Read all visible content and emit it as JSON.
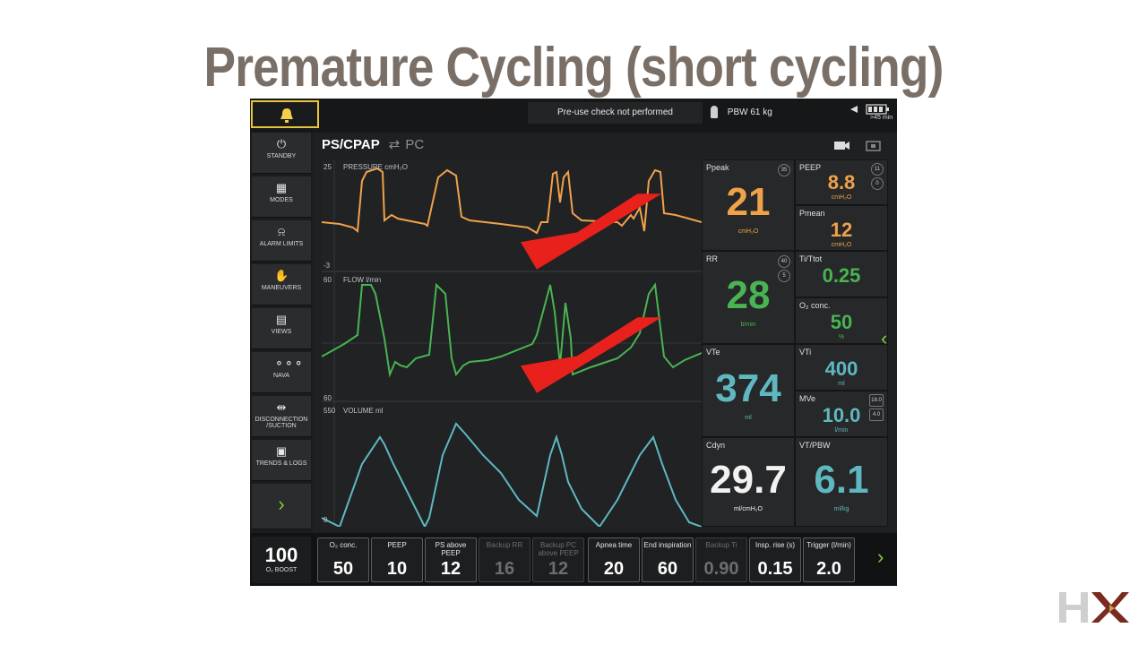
{
  "slide": {
    "title": "Premature Cycling (short cycling)"
  },
  "topbar": {
    "precheck": "Pre-use check not performed",
    "pbw": "PBW 61 kg",
    "battery_time": ">45 min"
  },
  "sidebar": {
    "items": [
      {
        "label": "STANDBY",
        "icon": "power-icon"
      },
      {
        "label": "MODES",
        "icon": "grid-icon"
      },
      {
        "label": "ALARM LIMITS",
        "icon": "alarm-limits-icon"
      },
      {
        "label": "MANEUVERS",
        "icon": "hand-icon"
      },
      {
        "label": "VIEWS",
        "icon": "views-icon"
      },
      {
        "label": "NAVA",
        "icon": "nava-icon"
      },
      {
        "label": "DISCONNECTION /SUCTION",
        "icon": "disconnect-icon"
      },
      {
        "label": "TRENDS & LOGS",
        "icon": "trends-icon"
      }
    ]
  },
  "mode": {
    "current": "PS/CPAP",
    "alternate": "PC"
  },
  "waveforms": {
    "pressure": {
      "label": "PRESSURE cmH₂O",
      "ymax": "25",
      "ymin": "-3",
      "color": "#f0a24a"
    },
    "flow": {
      "label": "FLOW l/min",
      "ymax": "60",
      "ymin": "60",
      "color": "#49b451"
    },
    "volume": {
      "label": "VOLUME ml",
      "ymax": "550",
      "ymin": "0",
      "color": "#5fb8c0"
    }
  },
  "measured": {
    "ppeak": {
      "label": "Ppeak",
      "value": "21",
      "unit": "cmH₂O",
      "limit": "35"
    },
    "peep": {
      "label": "PEEP",
      "value": "8.8",
      "unit": "cmH₂O",
      "limit_hi": "11",
      "limit_lo": "0"
    },
    "pmean": {
      "label": "Pmean",
      "value": "12",
      "unit": "cmH₂O"
    },
    "rr": {
      "label": "RR",
      "value": "28",
      "unit": "b/min",
      "limit_hi": "40",
      "limit_lo": "5"
    },
    "ti_ttot": {
      "label": "Ti/Ttot",
      "value": "0.25"
    },
    "o2": {
      "label": "O₂ conc.",
      "value": "50",
      "unit": "%"
    },
    "vte": {
      "label": "VTe",
      "value": "374",
      "unit": "ml"
    },
    "vti": {
      "label": "VTi",
      "value": "400",
      "unit": "ml"
    },
    "mve": {
      "label": "MVe",
      "value": "10.0",
      "unit": "l/min",
      "limit_hi": "18.0",
      "limit_lo": "4.0"
    },
    "cdyn": {
      "label": "Cdyn",
      "value": "29.7",
      "unit": "ml/cmH₂O"
    },
    "vt_pbw": {
      "label": "VT/PBW",
      "value": "6.1",
      "unit": "ml/kg"
    }
  },
  "settings": {
    "boost": {
      "value": "100",
      "label": "O₂ BOOST"
    },
    "items": [
      {
        "label": "O₂ conc.",
        "value": "50",
        "enabled": true
      },
      {
        "label": "PEEP",
        "value": "10",
        "enabled": true
      },
      {
        "label": "PS above PEEP",
        "value": "12",
        "enabled": true
      },
      {
        "label": "Backup RR",
        "value": "16",
        "enabled": false
      },
      {
        "label": "Backup PC above PEEP",
        "value": "12",
        "enabled": false
      },
      {
        "label": "Apnea time",
        "value": "20",
        "enabled": true
      },
      {
        "label": "End inspiration",
        "value": "60",
        "enabled": true
      },
      {
        "label": "Backup Ti",
        "value": "0.90",
        "enabled": false
      },
      {
        "label": "Insp. rise (s)",
        "value": "0.15",
        "enabled": true
      },
      {
        "label": "Trigger (l/min)",
        "value": "2.0",
        "enabled": true
      }
    ]
  },
  "logo": {
    "text": "HX",
    "colors": {
      "h": "#c9c9c9",
      "x": "#7a2a1f"
    }
  }
}
